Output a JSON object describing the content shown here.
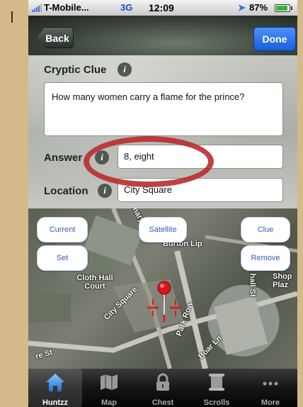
{
  "status_bar": {
    "carrier": "T-Mobile...",
    "network": "3G",
    "time": "12:09",
    "battery": "87%",
    "battery_level": 0.87
  },
  "nav": {
    "back_label": "Back",
    "done_label": "Done"
  },
  "form": {
    "clue_label": "Cryptic Clue",
    "clue_text": "How many women carry a flame for the prince?",
    "answer_label": "Answer",
    "answer_value": "8, eight",
    "location_label": "Location",
    "location_value": "City Square",
    "info_glyph": "i"
  },
  "map": {
    "buttons": {
      "current": "Current",
      "satellite": "Satellite",
      "clue": "Clue",
      "set": "Set",
      "remove": "Remove"
    },
    "labels": {
      "mary_st": "mary St",
      "burton_lip": "Burton Lip",
      "city_hall_court": "Cloth Hall Court",
      "city_square": "City Square",
      "park_row": "Park Row",
      "boar_ln": "Boar Ln",
      "shop_plaza": "Shop Plaz",
      "hall_st": "hall St",
      "re_st": "re St"
    }
  },
  "tabbar": {
    "tabs": [
      {
        "label": "Huntzz",
        "icon": "home-icon"
      },
      {
        "label": "Map",
        "icon": "map-icon"
      },
      {
        "label": "Chest",
        "icon": "lock-icon"
      },
      {
        "label": "Scrolls",
        "icon": "scroll-icon"
      },
      {
        "label": "More",
        "icon": "more-icon"
      }
    ]
  },
  "colors": {
    "done": "#1b5fdc",
    "highlight_circle": "#b92c2c",
    "map_button_text": "#2f5fae"
  }
}
